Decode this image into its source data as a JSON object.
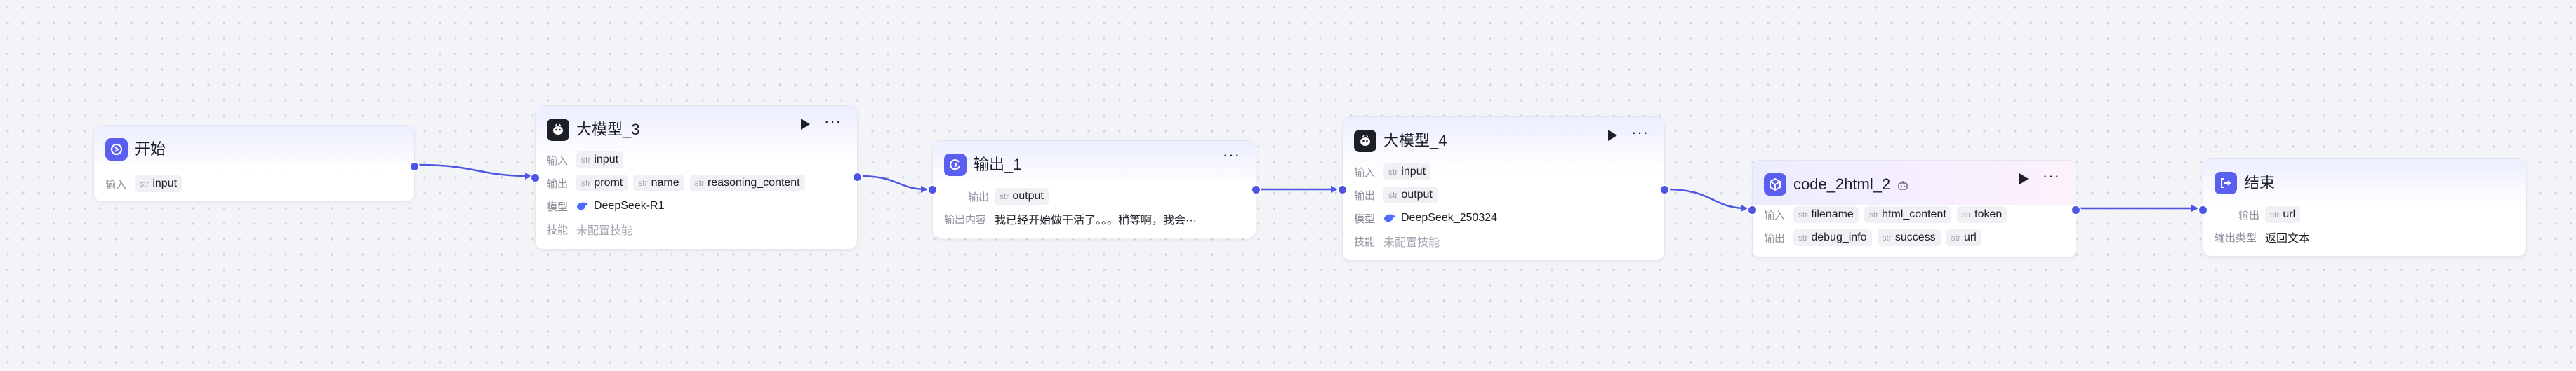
{
  "colors": {
    "accent": "#4d55e6",
    "icon_blue": "#5b5ff0",
    "icon_dark": "#1d1f26",
    "edge": "#4d55e6"
  },
  "nodes": {
    "start": {
      "title": "开始",
      "icon": "start-icon",
      "input_label": "输入",
      "inputs": [
        {
          "type": "str",
          "name": "input"
        }
      ]
    },
    "llm3": {
      "title": "大模型_3",
      "icon": "llm-icon",
      "input_label": "输入",
      "inputs": [
        {
          "type": "str",
          "name": "input"
        }
      ],
      "output_label": "输出",
      "outputs": [
        {
          "type": "str",
          "name": "promt"
        },
        {
          "type": "str",
          "name": "name"
        },
        {
          "type": "str",
          "name": "reasoning_content"
        }
      ],
      "model_label": "模型",
      "model": "DeepSeek-R1",
      "skill_label": "技能",
      "skill": "未配置技能"
    },
    "out1": {
      "title": "输出_1",
      "icon": "output-icon",
      "output_label": "输出",
      "outputs": [
        {
          "type": "str",
          "name": "output"
        }
      ],
      "content_label": "输出内容",
      "content": "我已经开始做干活了。。。稍等啊，我会···"
    },
    "llm4": {
      "title": "大模型_4",
      "icon": "llm-icon",
      "input_label": "输入",
      "inputs": [
        {
          "type": "str",
          "name": "input"
        }
      ],
      "output_label": "输出",
      "outputs": [
        {
          "type": "str",
          "name": "output"
        }
      ],
      "model_label": "模型",
      "model": "DeepSeek_250324",
      "skill_label": "技能",
      "skill": "未配置技能"
    },
    "code": {
      "title": "code_2html_2",
      "icon": "plugin-icon",
      "input_label": "输入",
      "inputs": [
        {
          "type": "str",
          "name": "filename"
        },
        {
          "type": "str",
          "name": "html_content"
        },
        {
          "type": "str",
          "name": "token"
        }
      ],
      "output_label": "输出",
      "outputs": [
        {
          "type": "str",
          "name": "debug_info"
        },
        {
          "type": "str",
          "name": "success"
        },
        {
          "type": "str",
          "name": "url"
        }
      ]
    },
    "end": {
      "title": "结束",
      "icon": "end-icon",
      "output_label": "输出",
      "outputs": [
        {
          "type": "str",
          "name": "url"
        }
      ],
      "output_type_label": "输出类型",
      "output_type": "返回文本"
    }
  }
}
